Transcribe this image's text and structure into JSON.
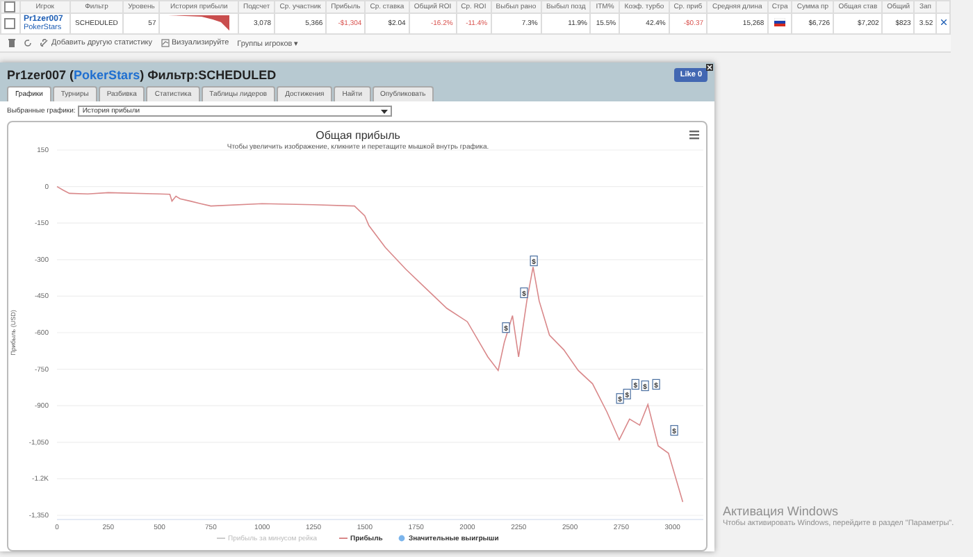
{
  "stats_table": {
    "columns": [
      "",
      "Игрок",
      "Фильтр",
      "Уровень",
      "История прибыли",
      "Подсчет",
      "Ср. участник",
      "Прибыль",
      "Ср. ставка",
      "Общий ROI",
      "Ср. ROI",
      "Выбыл рано",
      "Выбыл позд",
      "ITM%",
      "Коэф. турбо",
      "Ср. приб",
      "Средняя длина",
      "Стра",
      "Сумма пр",
      "Общая став",
      "Общий",
      "Зап",
      ""
    ],
    "select_all_checked": false,
    "rows": [
      {
        "cells": [
          {
            "kind": "checkbox",
            "checked": false
          },
          {
            "kind": "player",
            "player": "Pr1zer007",
            "network": "PokerStars"
          },
          {
            "kind": "text",
            "text": "SCHEDULED"
          },
          {
            "kind": "num",
            "text": "57"
          },
          {
            "kind": "sparkline"
          },
          {
            "kind": "num",
            "text": "3,078"
          },
          {
            "kind": "num",
            "text": "5,366"
          },
          {
            "kind": "neg",
            "text": "-$1,304"
          },
          {
            "kind": "num",
            "text": "$2.04"
          },
          {
            "kind": "neg",
            "text": "-16.2%"
          },
          {
            "kind": "neg",
            "text": "-11.4%"
          },
          {
            "kind": "num",
            "text": "7.3%"
          },
          {
            "kind": "num",
            "text": "11.9%"
          },
          {
            "kind": "num",
            "text": "15.5%"
          },
          {
            "kind": "num",
            "text": "42.4%"
          },
          {
            "kind": "neg",
            "text": "-$0.37"
          },
          {
            "kind": "num",
            "text": "15,268"
          },
          {
            "kind": "flag"
          },
          {
            "kind": "num",
            "text": "$6,726"
          },
          {
            "kind": "num",
            "text": "$7,202"
          },
          {
            "kind": "num",
            "text": "$823"
          },
          {
            "kind": "num",
            "text": "3.52"
          },
          {
            "kind": "remove"
          }
        ]
      }
    ]
  },
  "toolbar": {
    "items": [
      {
        "kind": "trash"
      },
      {
        "kind": "refresh"
      },
      {
        "kind": "addlink",
        "label": "Добавить другую статистику"
      },
      {
        "kind": "visualize",
        "label": "Визуализируйте"
      },
      {
        "kind": "menu",
        "label": "Группы игроков ▾"
      }
    ]
  },
  "dialog": {
    "title_start": "Pr1zer007 (",
    "title_network": "PokerStars",
    "title_end": ") Фильтр:SCHEDULED",
    "like_button": "Like 0",
    "tabs": [
      {
        "label": "Графики",
        "selected": true
      },
      {
        "label": "Турниры",
        "selected": false
      },
      {
        "label": "Разбивка",
        "selected": false
      },
      {
        "label": "Статистика",
        "selected": false
      },
      {
        "label": "Таблицы лидеров",
        "selected": false
      },
      {
        "label": "Достижения",
        "selected": false
      },
      {
        "label": "Найти",
        "selected": false
      },
      {
        "label": "Опубликовать",
        "selected": false
      }
    ],
    "graph_select_label": "Выбранные графики:",
    "graph_select_value": "История прибыли",
    "chart": {
      "subtitle": "Чтобы увеличить изображение, кликните и перетащите мышкой внутрь графика.",
      "legend": [
        {
          "kind": "hidden",
          "label": "Прибыль за минусом рейка"
        },
        {
          "kind": "series"
        },
        {
          "kind": "dot",
          "label": "Значительные выигрыши",
          "color": "#7cb5ec"
        }
      ],
      "chart_data": {
        "type": "line",
        "title": "Общая прибыль",
        "ylabel": "Прибыль (USD)",
        "grid": true,
        "x": [
          0,
          30,
          60,
          150,
          250,
          500,
          550,
          560,
          580,
          600,
          650,
          700,
          750,
          1000,
          1250,
          1450,
          1500,
          1520,
          1600,
          1700,
          1800,
          1900,
          2000,
          2100,
          2150,
          2180,
          2220,
          2250,
          2290,
          2320,
          2350,
          2400,
          2470,
          2540,
          2610,
          2680,
          2740,
          2790,
          2840,
          2880,
          2930,
          2980,
          3010,
          3050
        ],
        "series": [
          {
            "name": "Прибыль",
            "color": "#d9888a",
            "values": [
              0,
              -15,
              -28,
              -30,
              -25,
              -30,
              -32,
              -60,
              -40,
              -50,
              -60,
              -70,
              -80,
              -70,
              -75,
              -80,
              -120,
              -160,
              -250,
              -340,
              -420,
              -500,
              -555,
              -700,
              -755,
              -640,
              -530,
              -700,
              -470,
              -330,
              -470,
              -610,
              -670,
              -755,
              -810,
              -925,
              -1040,
              -955,
              -980,
              -895,
              -1065,
              -1095,
              -1180,
              -1295
            ]
          }
        ],
        "xlim": [
          0,
          3150
        ],
        "ylim": [
          -1350,
          150
        ],
        "xticks": [
          0,
          250,
          500,
          750,
          1000,
          1250,
          1500,
          1750,
          2000,
          2250,
          2500,
          2750,
          3000
        ],
        "yticks": [
          150,
          0,
          -150,
          -300,
          -450,
          -600,
          -750,
          -900,
          {
            "value": -1050,
            "label": "-1,050"
          },
          {
            "value": -1200,
            "label": "-1.2K"
          },
          {
            "value": -1350,
            "label": "-1,350"
          }
        ],
        "annotations": [
          {
            "x": 2188,
            "y": -582,
            "text": "$"
          },
          {
            "x": 2276,
            "y": -439,
            "text": "$"
          },
          {
            "x": 2324,
            "y": -308,
            "text": "$"
          },
          {
            "x": 2744,
            "y": -873,
            "text": "$"
          },
          {
            "x": 2778,
            "y": -855,
            "text": "$"
          },
          {
            "x": 2819,
            "y": -815,
            "text": "$"
          },
          {
            "x": 2866,
            "y": -821,
            "text": "$"
          },
          {
            "x": 2920,
            "y": -815,
            "text": "$"
          },
          {
            "x": 3008,
            "y": -1004,
            "text": "$"
          }
        ]
      }
    }
  },
  "os_notice": {
    "title": "Активация Windows",
    "text": "Чтобы активировать Windows, перейдите в раздел \"Параметры\"."
  }
}
